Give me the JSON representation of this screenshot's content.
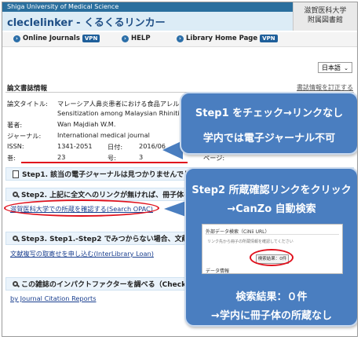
{
  "header": {
    "university": "Shiga University of Medical Science",
    "title": "cleclelinker - くるくるリンカー",
    "library_logo_line1": "滋賀医科大学",
    "library_logo_line2": "附属図書館"
  },
  "nav": {
    "items": [
      {
        "label": "Online Journals",
        "badge": "VPN"
      },
      {
        "label": "HELP",
        "badge": ""
      },
      {
        "label": "Library Home Page",
        "badge": "VPN"
      }
    ]
  },
  "language": {
    "selected": "日本語"
  },
  "section": {
    "title": "論文書誌情報",
    "correct_link": "書誌情報を訂正する"
  },
  "metadata": {
    "title_label": "論文タイトル:",
    "title_line1": "マレーシア人鼻炎患者における食品アレルゲン感作",
    "title_line2": "Sensitization among Malaysian Rhinitis Patients",
    "author_label": "著者:",
    "author": "Wan Majdiah W.M.",
    "journal_label": "ジャーナル:",
    "journal": "International medical journal",
    "issn_label": "ISSN:",
    "issn": "1341-2051",
    "date_label": "日付:",
    "date": "2016/06",
    "vol_label": "巻:",
    "vol": "23",
    "issue_label": "号:",
    "issue": "3",
    "page_label": "ページ:"
  },
  "steps": {
    "step1": "Step1. 該当の電子ジャーナルは見つかりませんでした",
    "step2": "Step2. 上記に全文へのリンクが無ければ、冊子体の所蔵を確認",
    "opac_link": "滋賀医科大学での所蔵を確認する(Search OPAC)",
    "step3": "Step3. Step1.-Step2 でみつからない場合、文献複写",
    "ill_link": "文献複写の取寄せを申し込む(InterLibrary Loan)",
    "impact": "この雑誌のインパクトファクターを調べる（Check",
    "jcr_link": "by Journal Citation Reports"
  },
  "callout1": {
    "line1": "Step1 をチェック→リンクなし",
    "line2": "学内では電子ジャーナル不可"
  },
  "callout2": {
    "line1": "Step2 所蔵確認リンクをクリック",
    "line2": "→CanZo 自動検索",
    "inset_tab": "外部データ検索（CiNii URL）",
    "inset_note": "リンク先から冊子の所蔵情報を確認してください",
    "inset_button": "検索結果：0件",
    "inset_footer": "データ情報",
    "result": "検索結果：０件",
    "conclusion": "→学内に冊子体の所蔵なし"
  },
  "colors": {
    "header_bar": "#2a6f9e",
    "callout": "#4a7ec0",
    "highlight_red": "#e0101c",
    "link": "#1a3f8f"
  }
}
